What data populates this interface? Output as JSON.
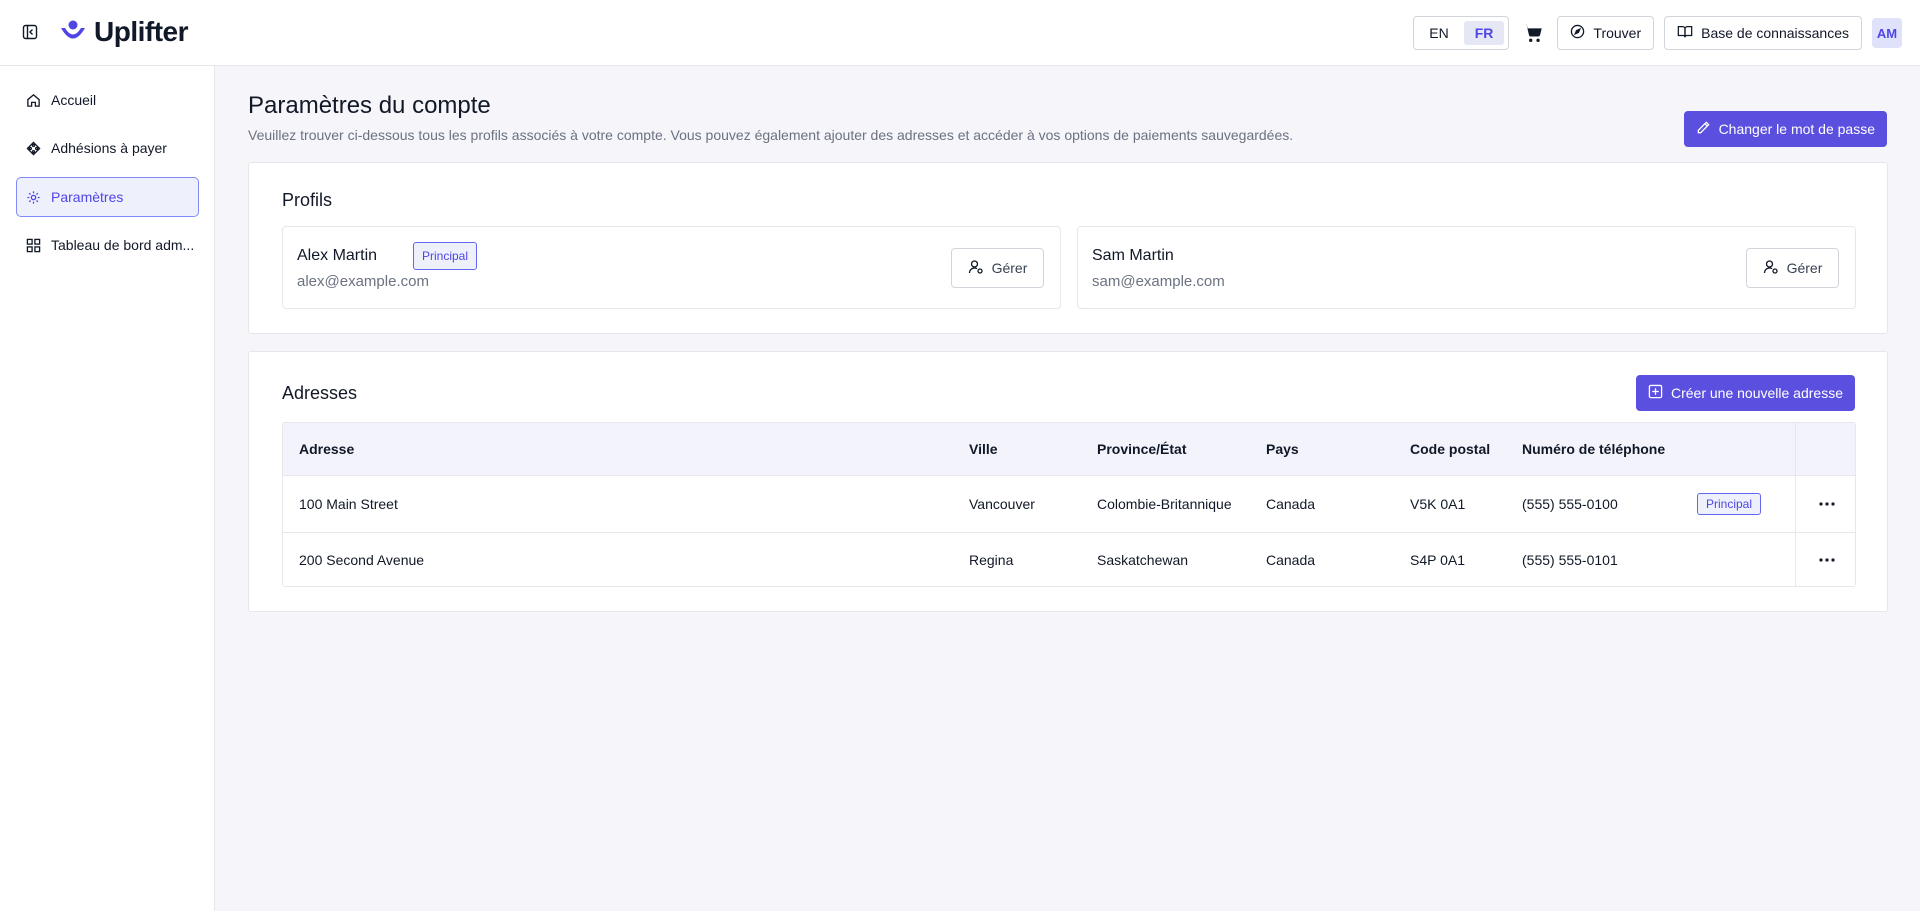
{
  "header": {
    "brand": "Uplifter",
    "languages": [
      {
        "code": "EN",
        "active": false
      },
      {
        "code": "FR",
        "active": true
      }
    ],
    "find_label": "Trouver",
    "knowledge_base_label": "Base de connaissances",
    "avatar_initials": "AM"
  },
  "sidebar": {
    "items": [
      {
        "label": "Accueil",
        "icon": "home-icon",
        "active": false
      },
      {
        "label": "Adhésions à payer",
        "icon": "tag-icon",
        "active": false
      },
      {
        "label": "Paramètres",
        "icon": "gear-icon",
        "active": true
      },
      {
        "label": "Tableau de bord adm...",
        "icon": "dashboard-icon",
        "active": false
      }
    ]
  },
  "page": {
    "title": "Paramètres du compte",
    "subtitle": "Veuillez trouver ci-dessous tous les profils associés à votre compte. Vous pouvez également ajouter des adresses et accéder à vos options de paiements sauvegardées.",
    "change_password_label": "Changer le mot de passe"
  },
  "profiles": {
    "title": "Profils",
    "items": [
      {
        "name": "Alex Martin",
        "email": "alex@example.com",
        "badge": "Principal",
        "manage_label": "Gérer"
      },
      {
        "name": "Sam Martin",
        "email": "sam@example.com",
        "badge": "",
        "manage_label": "Gérer"
      }
    ]
  },
  "addresses": {
    "title": "Adresses",
    "new_label": "Créer une nouvelle adresse",
    "columns": [
      "Adresse",
      "Ville",
      "Province/État",
      "Pays",
      "Code postal",
      "Numéro de téléphone"
    ],
    "rows": [
      {
        "address": "100 Main Street",
        "city": "Vancouver",
        "province": "Colombie-Britannique",
        "country": "Canada",
        "postal": "V5K 0A1",
        "phone": "(555) 555-0100",
        "badge": "Principal"
      },
      {
        "address": "200 Second Avenue",
        "city": "Regina",
        "province": "Saskatchewan",
        "country": "Canada",
        "postal": "S4P 0A1",
        "phone": "(555) 555-0101",
        "badge": ""
      }
    ]
  },
  "colors": {
    "accent": "#5b4fe0",
    "accent_text": "#4f46e5",
    "background": "#f5f5fa"
  }
}
